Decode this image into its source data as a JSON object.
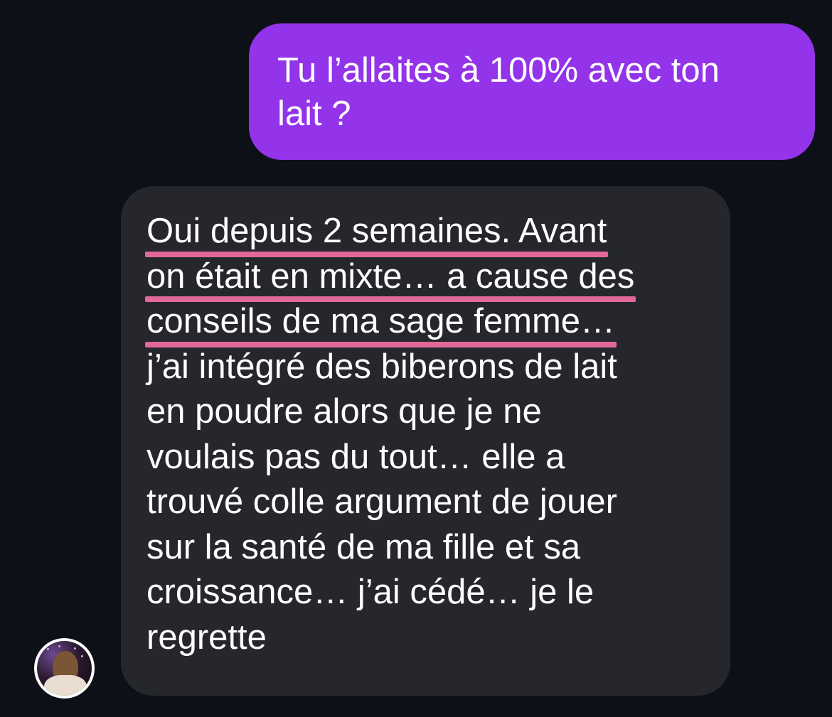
{
  "conversation": {
    "outgoing_message": {
      "text": "Tu l’allaites à 100% avec ton\nlait ?",
      "color": "#9333ea"
    },
    "incoming_message": {
      "lines": [
        "Oui depuis 2 semaines. Avant",
        "on était en mixte… a cause des",
        "conseils de ma sage femme…",
        "j’ai intégré des biberons de lait",
        "en poudre alors que je ne",
        "voulais pas du tout… elle a",
        "trouvé colle argument de jouer",
        "sur la santé de ma fille et sa",
        "croissance… j’ai cédé… je le",
        "regrette"
      ],
      "underlined_lines": [
        0,
        1,
        2
      ],
      "underline_color": "#e2689a",
      "color": "#26272c"
    },
    "sender_avatar": {
      "icon": "profile-photo"
    }
  },
  "theme": {
    "background": "#0d1117"
  }
}
